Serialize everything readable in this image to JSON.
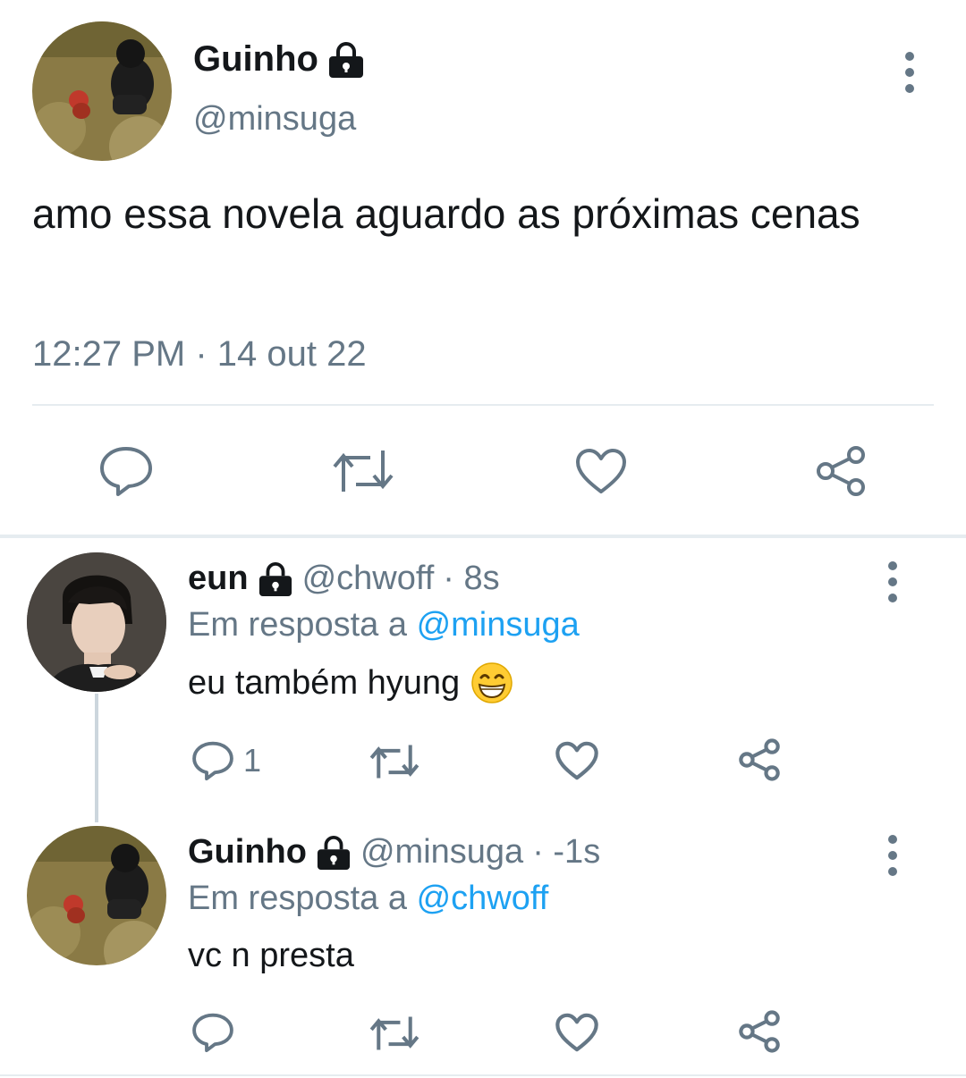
{
  "main_tweet": {
    "display_name": "Guinho",
    "handle": "@minsuga",
    "text": "amo essa novela aguardo as próximas cenas",
    "timestamp": "12:27 PM · 14 out 22",
    "actions": [
      "reply-icon",
      "retweet-icon",
      "like-icon",
      "share-icon"
    ]
  },
  "replies": [
    {
      "display_name": "eun",
      "handle": "@chwoff",
      "time": "· 8s",
      "reply_prefix": "Em resposta a",
      "reply_to": "@minsuga",
      "text": "eu também hyung",
      "emoji": "grinning-face-emoji",
      "reply_count": "1"
    },
    {
      "display_name": "Guinho",
      "handle": "@minsuga",
      "time": "· -1s",
      "reply_prefix": "Em resposta a",
      "reply_to": "@chwoff",
      "text": "vc n presta",
      "reply_count": ""
    }
  ],
  "colors": {
    "link": "#1da1f2",
    "muted": "#657786",
    "divider": "#e6ecf0"
  }
}
